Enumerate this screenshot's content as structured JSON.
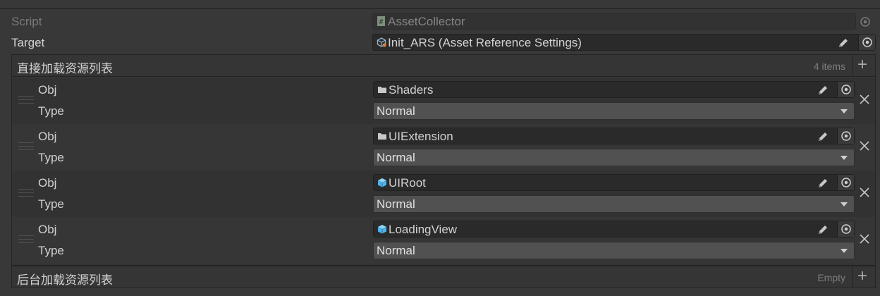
{
  "script_row": {
    "label": "Script",
    "value": "AssetCollector",
    "icon": "csharp-script-icon"
  },
  "target_row": {
    "label": "Target",
    "value": "Init_ARS (Asset Reference Settings)",
    "icon": "scriptable-object-icon"
  },
  "direct_list": {
    "title": "直接加载资源列表",
    "count": "4 items",
    "add_glyph": "+",
    "field_labels": {
      "obj": "Obj",
      "type": "Type"
    },
    "items": [
      {
        "obj": "Shaders",
        "obj_icon": "folder-icon",
        "type": "Normal"
      },
      {
        "obj": "UIExtension",
        "obj_icon": "folder-icon",
        "type": "Normal"
      },
      {
        "obj": "UIRoot",
        "obj_icon": "prefab-icon",
        "type": "Normal"
      },
      {
        "obj": "LoadingView",
        "obj_icon": "prefab-icon",
        "type": "Normal"
      }
    ]
  },
  "background_list": {
    "title": "后台加载资源列表",
    "count": "Empty",
    "add_glyph": "+"
  },
  "colors": {
    "background": "#383838",
    "field": "#2a2a2a",
    "dropdown": "#515151",
    "prefab_blue": "#4fb4ec",
    "text": "#d2d2d2"
  }
}
